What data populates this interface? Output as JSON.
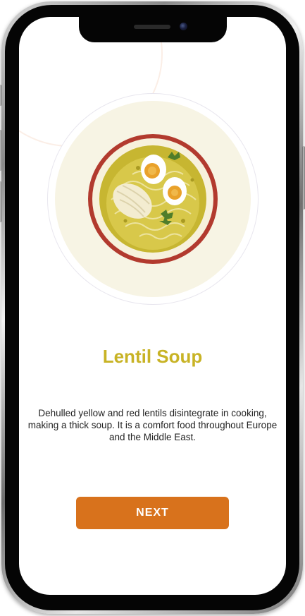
{
  "dish": {
    "title": "Lentil Soup",
    "description": "Dehulled yellow and red lentils disintegrate in cooking, making a thick soup. It is a comfort food throughout Europe and the Middle East.",
    "image_icon": "soup-bowl-illustration"
  },
  "actions": {
    "next_label": "NEXT"
  },
  "colors": {
    "title": "#c8b325",
    "button": "#d8721c",
    "plate_rim": "#b23a2e",
    "soup": "#c7b631",
    "circle_fill": "#f7f4e4"
  }
}
